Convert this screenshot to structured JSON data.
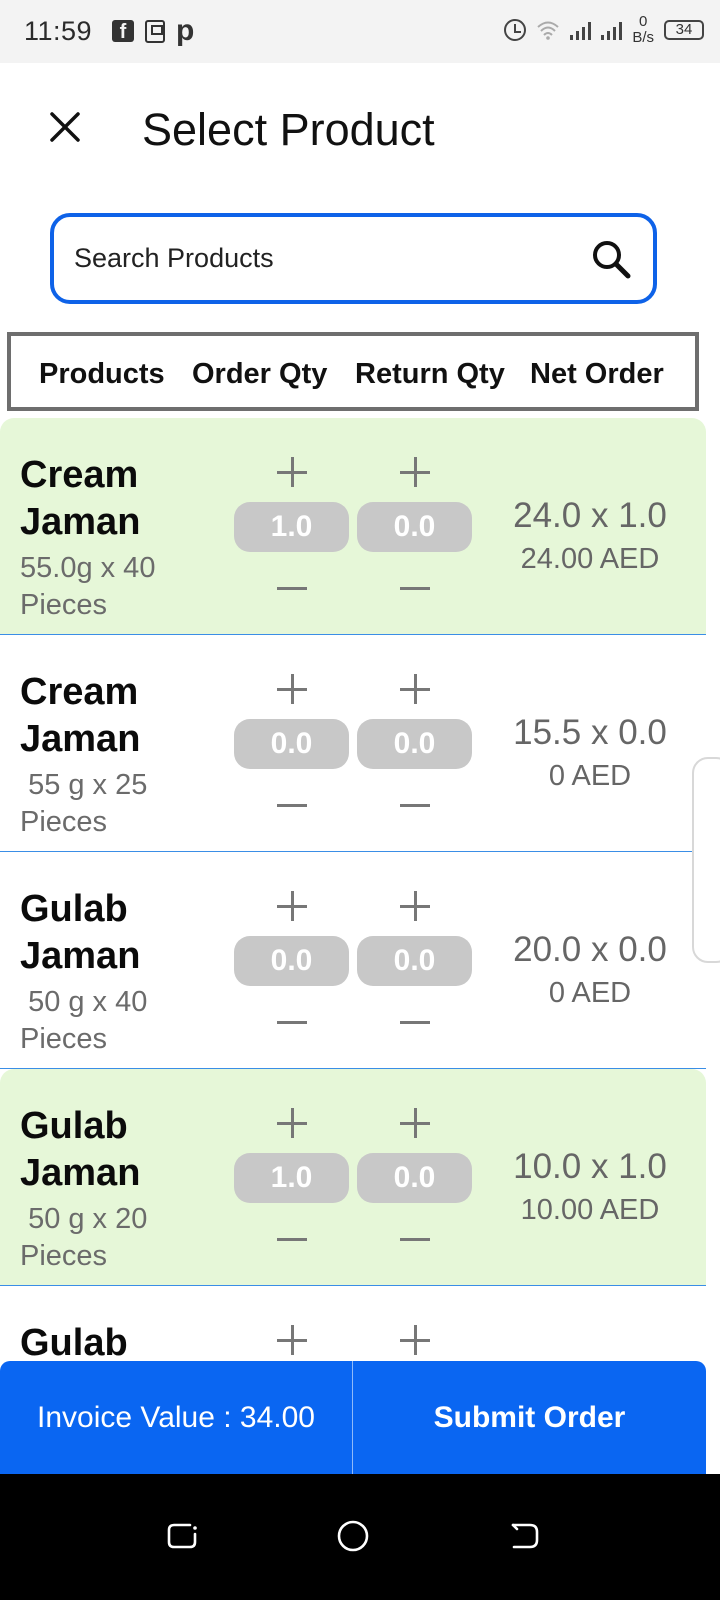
{
  "status_bar": {
    "time": "11:59",
    "fb_glyph": "f",
    "p_glyph": "p",
    "net_speed_value": "0",
    "net_speed_unit": "B/s",
    "battery": "34",
    "icons": [
      "facebook-icon",
      "sim-icon",
      "p-icon",
      "alarm-icon",
      "wifi-icon",
      "signal-icon",
      "battery-icon"
    ]
  },
  "header": {
    "title": "Select Product",
    "close_icon": "close-icon"
  },
  "search": {
    "placeholder": "Search Products",
    "value": "",
    "icon": "search-icon"
  },
  "table": {
    "columns": [
      "Products",
      "Order Qty",
      "Return Qty",
      "Net Order"
    ],
    "rows": [
      {
        "name": "Cream Jaman",
        "size": "55.0g x 40 Pieces",
        "order_qty": "1.0",
        "return_qty": "0.0",
        "net_calc": "24.0 x 1.0",
        "net_amount": "24.00 AED",
        "selected": true
      },
      {
        "name": "Cream Jaman",
        "size": " 55 g x 25 Pieces",
        "order_qty": "0.0",
        "return_qty": "0.0",
        "net_calc": "15.5 x 0.0",
        "net_amount": "0 AED",
        "selected": false
      },
      {
        "name": "Gulab Jaman",
        "size": " 50 g x 40 Pieces",
        "order_qty": "0.0",
        "return_qty": "0.0",
        "net_calc": "20.0 x 0.0",
        "net_amount": "0 AED",
        "selected": false
      },
      {
        "name": "Gulab Jaman",
        "size": " 50 g x 20 Pieces",
        "order_qty": "1.0",
        "return_qty": "0.0",
        "net_calc": "10.0 x 1.0",
        "net_amount": "10.00 AED",
        "selected": true
      },
      {
        "name": "Gulab"
      }
    ]
  },
  "footer": {
    "invoice_label": "Invoice Value : 34.00",
    "submit_label": "Submit Order"
  },
  "colors": {
    "accent": "#0a66f2",
    "search_border": "#0e62e8",
    "selected_row": "#e6f7d8",
    "qty_pill": "#c8c8c8"
  }
}
